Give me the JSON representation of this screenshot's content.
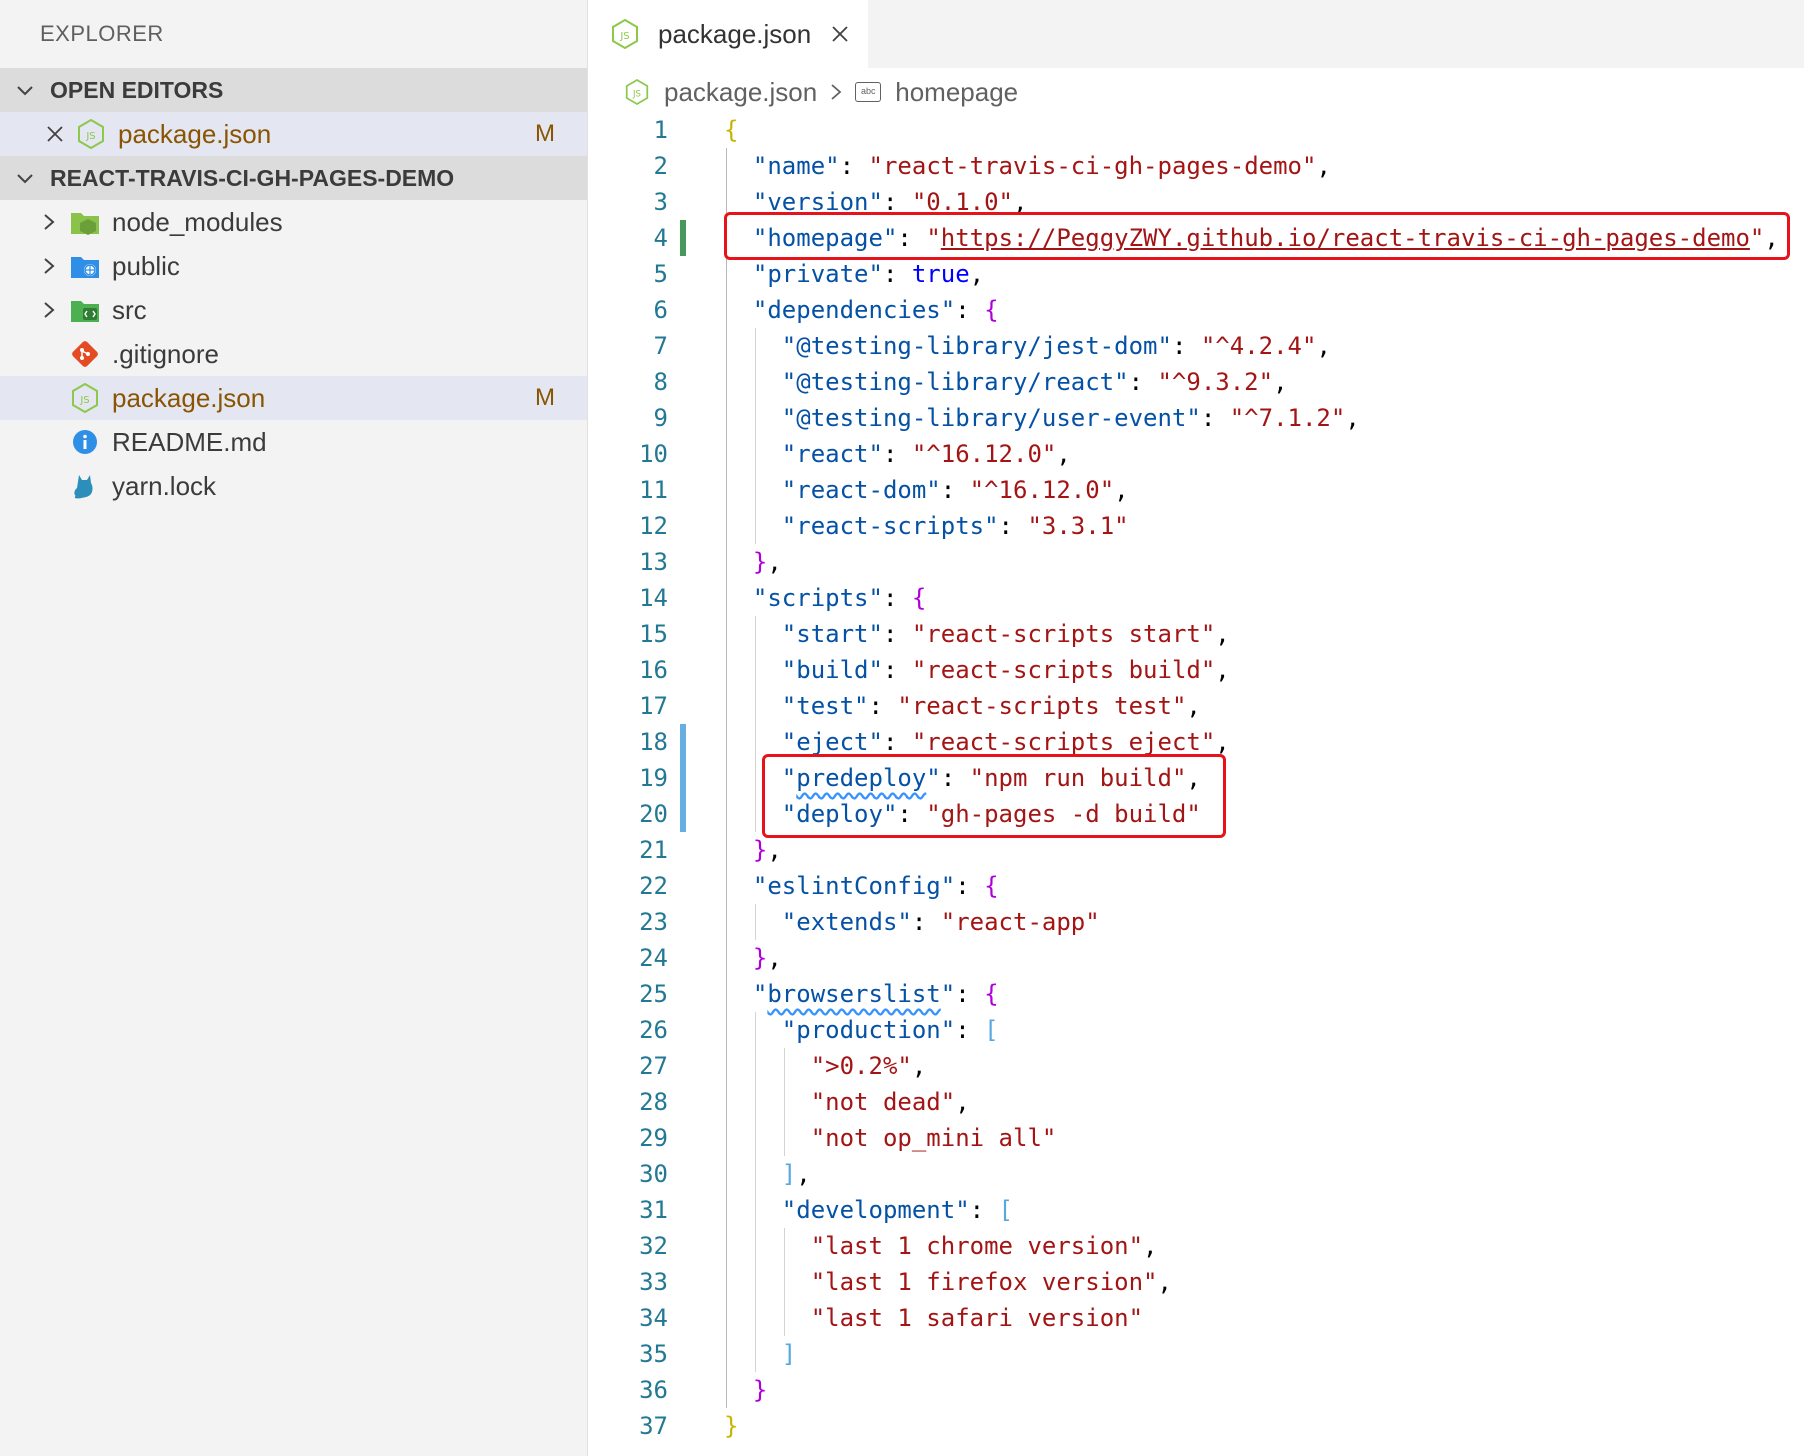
{
  "sidebar": {
    "title": "EXPLORER",
    "open_editors": {
      "header": "OPEN EDITORS",
      "items": [
        {
          "label": "package.json",
          "badge": "M",
          "icon": "node-json-icon"
        }
      ]
    },
    "project": {
      "header": "REACT-TRAVIS-CI-GH-PAGES-DEMO",
      "items": [
        {
          "label": "node_modules",
          "type": "folder",
          "icon": "node-folder-icon"
        },
        {
          "label": "public",
          "type": "folder",
          "icon": "public-folder-icon"
        },
        {
          "label": "src",
          "type": "folder",
          "icon": "src-folder-icon"
        },
        {
          "label": ".gitignore",
          "type": "file",
          "icon": "git-icon"
        },
        {
          "label": "package.json",
          "type": "file",
          "icon": "node-json-icon",
          "badge": "M"
        },
        {
          "label": "README.md",
          "type": "file",
          "icon": "info-icon"
        },
        {
          "label": "yarn.lock",
          "type": "file",
          "icon": "yarn-cat-icon"
        }
      ]
    }
  },
  "editor": {
    "tab": {
      "label": "package.json"
    },
    "breadcrumb": {
      "file": "package.json",
      "symbol": "homepage",
      "symbol_icon_text": "abc"
    },
    "colors": {
      "key": "#0451a5",
      "string": "#a31515",
      "boolean": "#0000ff",
      "bracket_level0": "#c8b400",
      "bracket_level1": "#af00db",
      "bracket_level2": "#58a8e0",
      "highlight_box": "#e8121a"
    },
    "lines": [
      {
        "n": "1",
        "segs": [
          [
            "p0",
            "{"
          ]
        ]
      },
      {
        "n": "2",
        "segs": [
          [
            "t",
            "  "
          ],
          [
            "k",
            "\"name\""
          ],
          [
            "t",
            ": "
          ],
          [
            "s",
            "\"react-travis-ci-gh-pages-demo\""
          ],
          [
            "t",
            ","
          ]
        ]
      },
      {
        "n": "3",
        "segs": [
          [
            "t",
            "  "
          ],
          [
            "k",
            "\"version\""
          ],
          [
            "t",
            ": "
          ],
          [
            "s",
            "\"0.1.0\""
          ],
          [
            "t",
            ","
          ]
        ]
      },
      {
        "n": "4",
        "segs": [
          [
            "t",
            "  "
          ],
          [
            "k",
            "\"homepage\""
          ],
          [
            "t",
            ": "
          ],
          [
            "s",
            "\""
          ],
          [
            "url",
            "https://PeggyZWY.github.io/react-travis-ci-gh-pages-demo"
          ],
          [
            "s",
            "\""
          ],
          [
            "t",
            ","
          ]
        ]
      },
      {
        "n": "5",
        "segs": [
          [
            "t",
            "  "
          ],
          [
            "k",
            "\"private\""
          ],
          [
            "t",
            ": "
          ],
          [
            "b",
            "true"
          ],
          [
            "t",
            ","
          ]
        ]
      },
      {
        "n": "6",
        "segs": [
          [
            "t",
            "  "
          ],
          [
            "k",
            "\"dependencies\""
          ],
          [
            "t",
            ": "
          ],
          [
            "p1",
            "{"
          ]
        ]
      },
      {
        "n": "7",
        "segs": [
          [
            "t",
            "    "
          ],
          [
            "k",
            "\"@testing-library/jest-dom\""
          ],
          [
            "t",
            ": "
          ],
          [
            "s",
            "\"^4.2.4\""
          ],
          [
            "t",
            ","
          ]
        ]
      },
      {
        "n": "8",
        "segs": [
          [
            "t",
            "    "
          ],
          [
            "k",
            "\"@testing-library/react\""
          ],
          [
            "t",
            ": "
          ],
          [
            "s",
            "\"^9.3.2\""
          ],
          [
            "t",
            ","
          ]
        ]
      },
      {
        "n": "9",
        "segs": [
          [
            "t",
            "    "
          ],
          [
            "k",
            "\"@testing-library/user-event\""
          ],
          [
            "t",
            ": "
          ],
          [
            "s",
            "\"^7.1.2\""
          ],
          [
            "t",
            ","
          ]
        ]
      },
      {
        "n": "10",
        "segs": [
          [
            "t",
            "    "
          ],
          [
            "k",
            "\"react\""
          ],
          [
            "t",
            ": "
          ],
          [
            "s",
            "\"^16.12.0\""
          ],
          [
            "t",
            ","
          ]
        ]
      },
      {
        "n": "11",
        "segs": [
          [
            "t",
            "    "
          ],
          [
            "k",
            "\"react-dom\""
          ],
          [
            "t",
            ": "
          ],
          [
            "s",
            "\"^16.12.0\""
          ],
          [
            "t",
            ","
          ]
        ]
      },
      {
        "n": "12",
        "segs": [
          [
            "t",
            "    "
          ],
          [
            "k",
            "\"react-scripts\""
          ],
          [
            "t",
            ": "
          ],
          [
            "s",
            "\"3.3.1\""
          ]
        ]
      },
      {
        "n": "13",
        "segs": [
          [
            "t",
            "  "
          ],
          [
            "p1",
            "}"
          ],
          [
            "t",
            ","
          ]
        ]
      },
      {
        "n": "14",
        "segs": [
          [
            "t",
            "  "
          ],
          [
            "k",
            "\"scripts\""
          ],
          [
            "t",
            ": "
          ],
          [
            "p1",
            "{"
          ]
        ]
      },
      {
        "n": "15",
        "segs": [
          [
            "t",
            "    "
          ],
          [
            "k",
            "\"start\""
          ],
          [
            "t",
            ": "
          ],
          [
            "s",
            "\"react-scripts start\""
          ],
          [
            "t",
            ","
          ]
        ]
      },
      {
        "n": "16",
        "segs": [
          [
            "t",
            "    "
          ],
          [
            "k",
            "\"build\""
          ],
          [
            "t",
            ": "
          ],
          [
            "s",
            "\"react-scripts build\""
          ],
          [
            "t",
            ","
          ]
        ]
      },
      {
        "n": "17",
        "segs": [
          [
            "t",
            "    "
          ],
          [
            "k",
            "\"test\""
          ],
          [
            "t",
            ": "
          ],
          [
            "s",
            "\"react-scripts test\""
          ],
          [
            "t",
            ","
          ]
        ]
      },
      {
        "n": "18",
        "segs": [
          [
            "t",
            "    "
          ],
          [
            "k",
            "\"eject\""
          ],
          [
            "t",
            ": "
          ],
          [
            "s",
            "\"react-scripts eject\""
          ],
          [
            "t",
            ","
          ]
        ]
      },
      {
        "n": "19",
        "segs": [
          [
            "t",
            "    "
          ],
          [
            "k",
            "\""
          ],
          [
            "ksq",
            "predeploy"
          ],
          [
            "k",
            "\""
          ],
          [
            "t",
            ": "
          ],
          [
            "s",
            "\"npm run build\""
          ],
          [
            "t",
            ","
          ]
        ]
      },
      {
        "n": "20",
        "segs": [
          [
            "t",
            "    "
          ],
          [
            "k",
            "\"deploy\""
          ],
          [
            "t",
            ": "
          ],
          [
            "s",
            "\"gh-pages -d build\""
          ]
        ]
      },
      {
        "n": "21",
        "segs": [
          [
            "t",
            "  "
          ],
          [
            "p1",
            "}"
          ],
          [
            "t",
            ","
          ]
        ]
      },
      {
        "n": "22",
        "segs": [
          [
            "t",
            "  "
          ],
          [
            "k",
            "\"eslintConfig\""
          ],
          [
            "t",
            ": "
          ],
          [
            "p1",
            "{"
          ]
        ]
      },
      {
        "n": "23",
        "segs": [
          [
            "t",
            "    "
          ],
          [
            "k",
            "\"extends\""
          ],
          [
            "t",
            ": "
          ],
          [
            "s",
            "\"react-app\""
          ]
        ]
      },
      {
        "n": "24",
        "segs": [
          [
            "t",
            "  "
          ],
          [
            "p1",
            "}"
          ],
          [
            "t",
            ","
          ]
        ]
      },
      {
        "n": "25",
        "segs": [
          [
            "t",
            "  "
          ],
          [
            "k",
            "\""
          ],
          [
            "ksq",
            "browserslist"
          ],
          [
            "k",
            "\""
          ],
          [
            "t",
            ": "
          ],
          [
            "p1",
            "{"
          ]
        ]
      },
      {
        "n": "26",
        "segs": [
          [
            "t",
            "    "
          ],
          [
            "k",
            "\"production\""
          ],
          [
            "t",
            ": "
          ],
          [
            "p2",
            "["
          ]
        ]
      },
      {
        "n": "27",
        "segs": [
          [
            "t",
            "      "
          ],
          [
            "s",
            "\">0.2%\""
          ],
          [
            "t",
            ","
          ]
        ]
      },
      {
        "n": "28",
        "segs": [
          [
            "t",
            "      "
          ],
          [
            "s",
            "\"not dead\""
          ],
          [
            "t",
            ","
          ]
        ]
      },
      {
        "n": "29",
        "segs": [
          [
            "t",
            "      "
          ],
          [
            "s",
            "\"not op_mini all\""
          ]
        ]
      },
      {
        "n": "30",
        "segs": [
          [
            "t",
            "    "
          ],
          [
            "p2",
            "]"
          ],
          [
            "t",
            ","
          ]
        ]
      },
      {
        "n": "31",
        "segs": [
          [
            "t",
            "    "
          ],
          [
            "k",
            "\"development\""
          ],
          [
            "t",
            ": "
          ],
          [
            "p2",
            "["
          ]
        ]
      },
      {
        "n": "32",
        "segs": [
          [
            "t",
            "      "
          ],
          [
            "s",
            "\"last 1 chrome version\""
          ],
          [
            "t",
            ","
          ]
        ]
      },
      {
        "n": "33",
        "segs": [
          [
            "t",
            "      "
          ],
          [
            "s",
            "\"last 1 firefox version\""
          ],
          [
            "t",
            ","
          ]
        ]
      },
      {
        "n": "34",
        "segs": [
          [
            "t",
            "      "
          ],
          [
            "s",
            "\"last 1 safari version\""
          ]
        ]
      },
      {
        "n": "35",
        "segs": [
          [
            "t",
            "    "
          ],
          [
            "p2",
            "]"
          ]
        ]
      },
      {
        "n": "36",
        "segs": [
          [
            "t",
            "  "
          ],
          [
            "p1",
            "}"
          ]
        ]
      },
      {
        "n": "37",
        "segs": [
          [
            "p0",
            "}"
          ]
        ]
      }
    ],
    "git_gutter": {
      "4": "added",
      "18": "modified",
      "19": "modified",
      "20": "modified"
    }
  }
}
